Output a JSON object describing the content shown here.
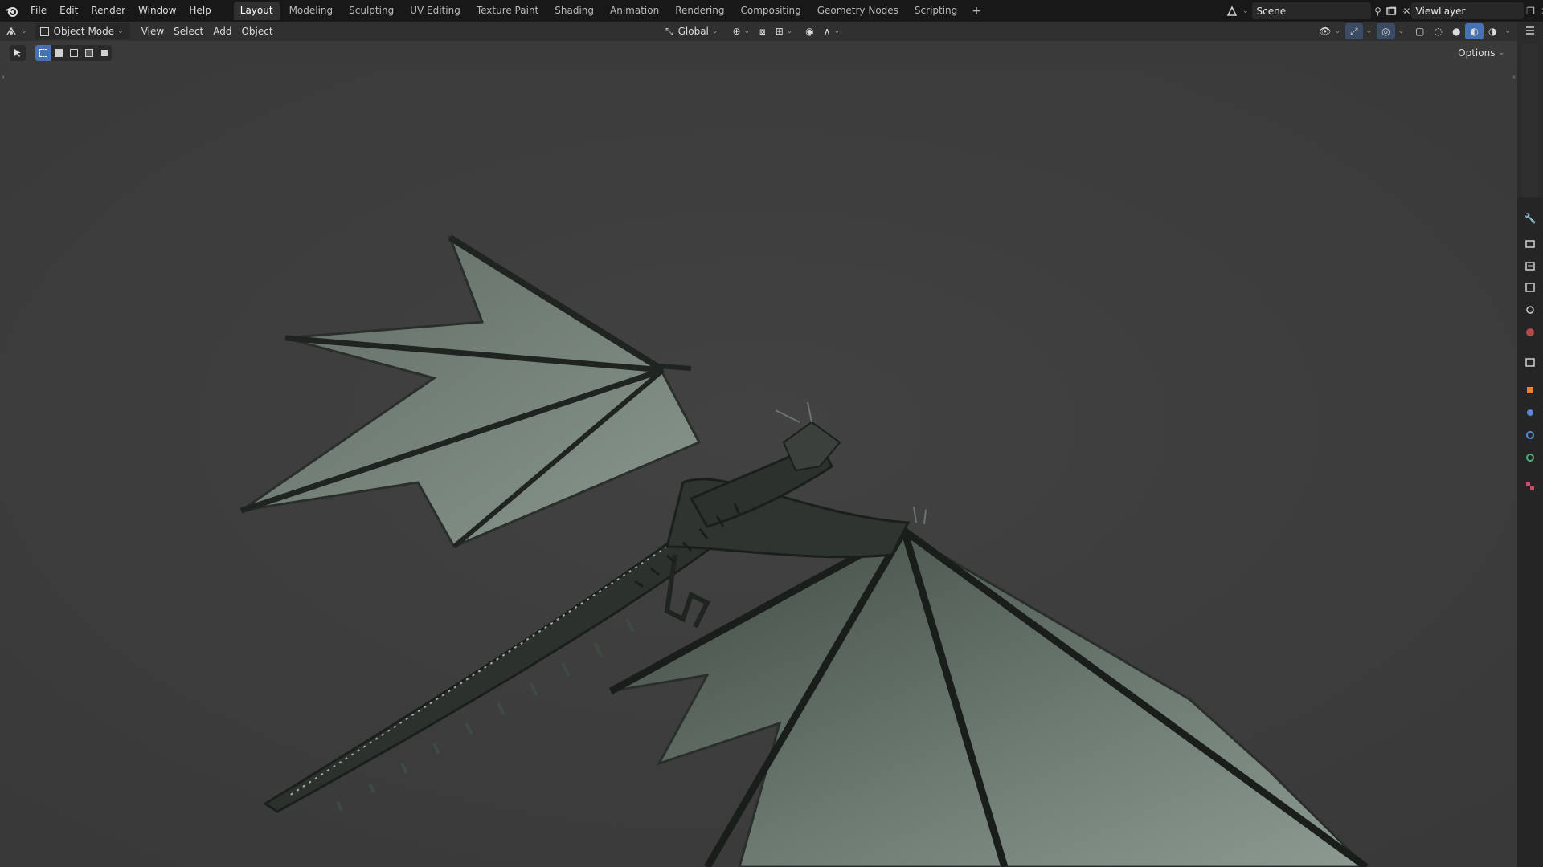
{
  "menu": [
    "File",
    "Edit",
    "Render",
    "Window",
    "Help"
  ],
  "tabs": [
    "Layout",
    "Modeling",
    "Sculpting",
    "UV Editing",
    "Texture Paint",
    "Shading",
    "Animation",
    "Rendering",
    "Compositing",
    "Geometry Nodes",
    "Scripting"
  ],
  "active_tab": "Layout",
  "scene": {
    "name": "Scene"
  },
  "view_layer": {
    "name": "ViewLayer"
  },
  "header": {
    "mode": "Object Mode",
    "view": "View",
    "select": "Select",
    "add": "Add",
    "object": "Object",
    "orientation": "Global"
  },
  "toolbar": {
    "options": "Options"
  },
  "colors": {
    "accent": "#4772b3",
    "viewport_bg": "#3d3d3d",
    "topbar_bg": "#181818",
    "header_bg": "#303030"
  },
  "icons": [
    "blender-logo-icon",
    "editor-type-icon",
    "object-mode-icon",
    "transform-orientation-icon",
    "pivot-icon",
    "snap-icon",
    "proportional-edit-icon",
    "visibility-icon",
    "gizmo-icon",
    "overlay-icon",
    "xray-icon",
    "wireframe-shading-icon",
    "solid-shading-icon",
    "material-shading-icon",
    "rendered-shading-icon",
    "tool-icon",
    "render-properties-icon",
    "output-properties-icon",
    "view-layer-icon",
    "scene-icon",
    "world-icon",
    "collection-icon",
    "object-properties-icon",
    "modifier-icon",
    "particles-icon",
    "physics-icon",
    "constraints-icon",
    "data-icon",
    "texture-icon"
  ]
}
